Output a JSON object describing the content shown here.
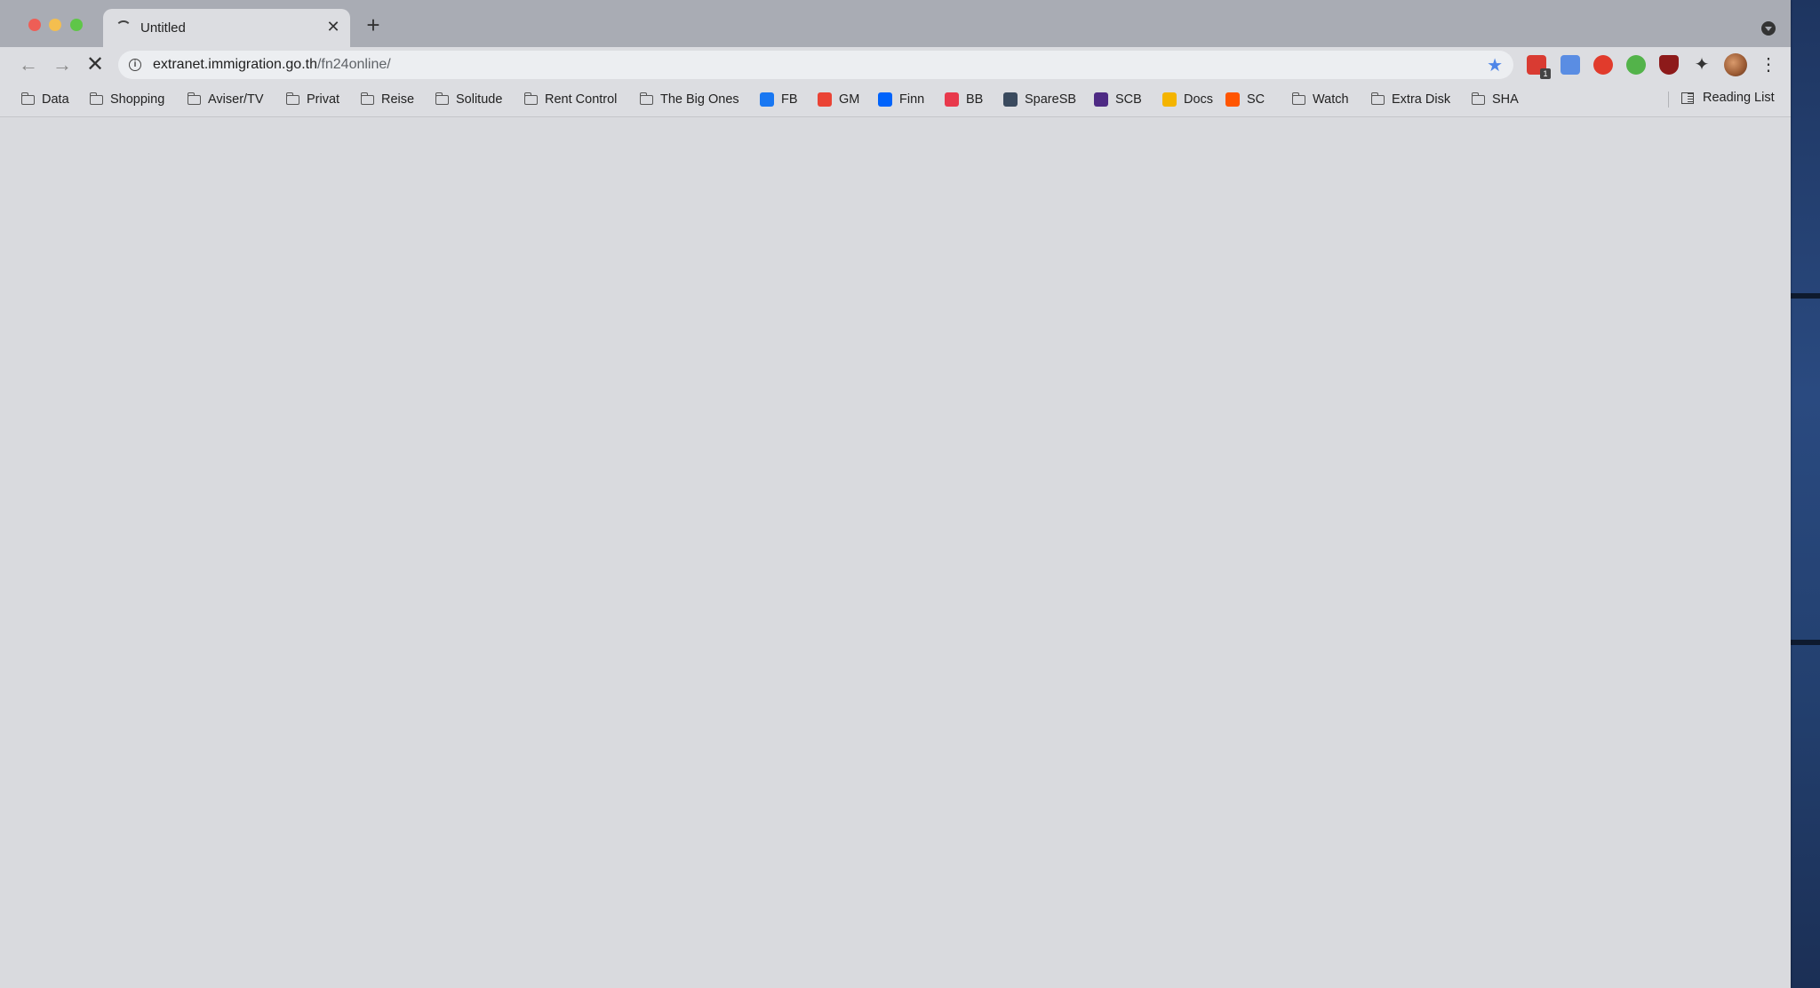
{
  "tab": {
    "title": "Untitled",
    "close_glyph": "✕",
    "loading_icon": "spinner-icon"
  },
  "new_tab_glyph": "+",
  "toolbar": {
    "back_glyph": "←",
    "forward_glyph": "→",
    "stop_glyph": "✕",
    "url_host": "extranet.immigration.go.th",
    "url_path": "/fn24online/",
    "star_icon": "bookmark-star-icon",
    "extension_badge": "1"
  },
  "bookmarks": [
    {
      "label": "Data",
      "type": "folder"
    },
    {
      "label": "Shopping",
      "type": "folder"
    },
    {
      "label": "Aviser/TV",
      "type": "folder"
    },
    {
      "label": "Privat",
      "type": "folder"
    },
    {
      "label": "Reise",
      "type": "folder"
    },
    {
      "label": "Solitude",
      "type": "folder"
    },
    {
      "label": "Rent Control",
      "type": "folder"
    },
    {
      "label": "The Big Ones",
      "type": "folder"
    },
    {
      "label": "FB",
      "type": "link",
      "icon": "facebook-icon",
      "color": "#1877f2"
    },
    {
      "label": "GM",
      "type": "link",
      "icon": "gmail-icon",
      "color": "#ea4335"
    },
    {
      "label": "Finn",
      "type": "link",
      "icon": "finn-icon",
      "color": "#0063fb"
    },
    {
      "label": "BB",
      "type": "link",
      "icon": "bb-icon",
      "color": "#e8394c"
    },
    {
      "label": "SpareSB",
      "type": "link",
      "icon": "sparebank-icon",
      "color": "#3a4a5e"
    },
    {
      "label": "SCB",
      "type": "link",
      "icon": "scb-icon",
      "color": "#4e2a84"
    },
    {
      "label": "Docs",
      "type": "link",
      "icon": "google-drive-icon",
      "color": "#f4b400"
    },
    {
      "label": "SC",
      "type": "link",
      "icon": "soundcloud-icon",
      "color": "#ff5500"
    },
    {
      "label": "Watch",
      "type": "folder"
    },
    {
      "label": "Extra Disk",
      "type": "folder"
    },
    {
      "label": "SHA",
      "type": "folder"
    }
  ],
  "reading_list": "Reading List"
}
